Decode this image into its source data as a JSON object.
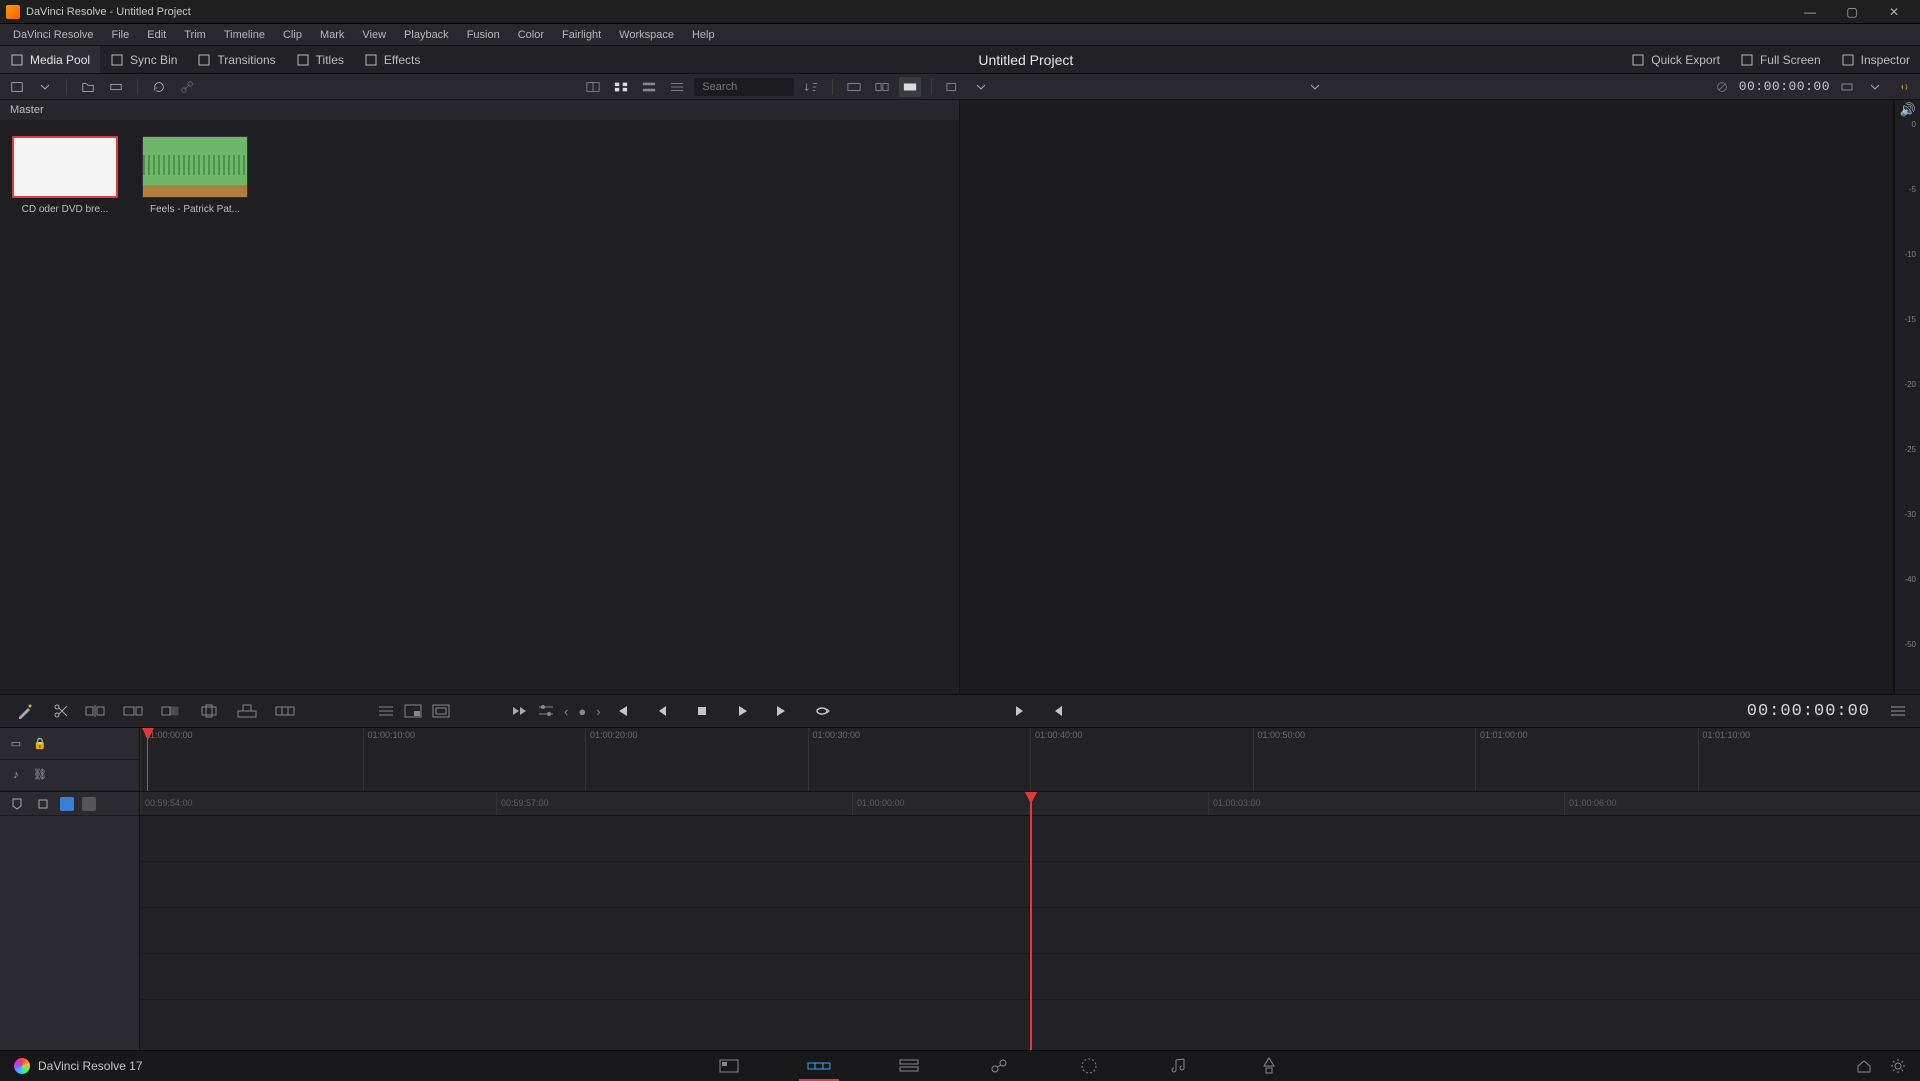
{
  "window": {
    "title": "DaVinci Resolve - Untitled Project"
  },
  "menu": {
    "items": [
      "DaVinci Resolve",
      "File",
      "Edit",
      "Trim",
      "Timeline",
      "Clip",
      "Mark",
      "View",
      "Playback",
      "Fusion",
      "Color",
      "Fairlight",
      "Workspace",
      "Help"
    ]
  },
  "panels": {
    "left": [
      {
        "id": "media-pool",
        "label": "Media Pool",
        "icon": "media-pool-icon",
        "active": true
      },
      {
        "id": "sync-bin",
        "label": "Sync Bin",
        "icon": "sync-bin-icon"
      },
      {
        "id": "transitions",
        "label": "Transitions",
        "icon": "transitions-icon"
      },
      {
        "id": "titles",
        "label": "Titles",
        "icon": "titles-icon"
      },
      {
        "id": "effects",
        "label": "Effects",
        "icon": "effects-icon"
      }
    ],
    "center_title": "Untitled Project",
    "right": [
      {
        "id": "quick-export",
        "label": "Quick Export",
        "icon": "quick-export-icon"
      },
      {
        "id": "full-screen",
        "label": "Full Screen",
        "icon": "full-screen-icon"
      },
      {
        "id": "inspector",
        "label": "Inspector",
        "icon": "inspector-icon"
      }
    ]
  },
  "sectoolbar": {
    "search_placeholder": "Search",
    "source_timecode": "00:00:00:00"
  },
  "media_pool": {
    "bin_path": "Master",
    "clips": [
      {
        "name": "CD oder DVD bre...",
        "type": "video"
      },
      {
        "name": "Feels - Patrick Pat...",
        "type": "audio"
      }
    ]
  },
  "audio_meter": {
    "ticks": [
      "0",
      "-5",
      "-10",
      "-15",
      "-20",
      "-25",
      "-30",
      "-40",
      "-50"
    ]
  },
  "upper_timeline": {
    "ticks": [
      "01:00:00:00",
      "01:00:10:00",
      "01:00:20:00",
      "01:00:30:00",
      "01:00:40:00",
      "01:00:50:00",
      "01:01:00:00",
      "01:01:10:00"
    ]
  },
  "lower_timeline": {
    "ticks": [
      "00:59:54:00",
      "00:59:57:00",
      "01:00:00:00",
      "01:00:03:00",
      "01:00:06:00"
    ]
  },
  "viewer_timecode": "00:00:00:00",
  "pagebar": {
    "brand": "DaVinci Resolve 17"
  }
}
